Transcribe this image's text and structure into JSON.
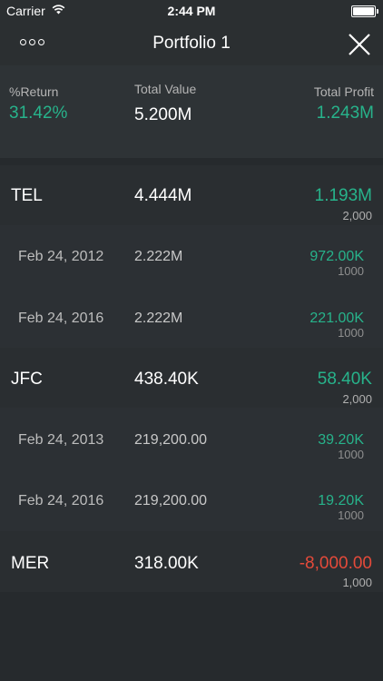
{
  "status": {
    "carrier": "Carrier",
    "time": "2:44 PM"
  },
  "nav": {
    "title": "Portfolio 1"
  },
  "summary": {
    "return_label": "%Return",
    "return_value": "31.42%",
    "value_label": "Total Value",
    "value_value": "5.200M",
    "profit_label": "Total Profit",
    "profit_value": "1.243M"
  },
  "holdings": [
    {
      "symbol": "TEL",
      "value": "4.444M",
      "profit": "1.193M",
      "quantity": "2,000",
      "lots": [
        {
          "date": "Feb 24, 2012",
          "value": "2.222M",
          "profit": "972.00K",
          "quantity": "1000"
        },
        {
          "date": "Feb 24, 2016",
          "value": "2.222M",
          "profit": "221.00K",
          "quantity": "1000"
        }
      ]
    },
    {
      "symbol": "JFC",
      "value": "438.40K",
      "profit": "58.40K",
      "quantity": "2,000",
      "lots": [
        {
          "date": "Feb 24, 2013",
          "value": "219,200.00",
          "profit": "39.20K",
          "quantity": "1000"
        },
        {
          "date": "Feb 24, 2016",
          "value": "219,200.00",
          "profit": "19.20K",
          "quantity": "1000"
        }
      ]
    },
    {
      "symbol": "MER",
      "value": "318.00K",
      "profit": "-8,000.00",
      "quantity": "1,000",
      "lots": []
    }
  ],
  "colors": {
    "gain": "#27b38b",
    "loss": "#e44a3a",
    "background": "#262a2d"
  }
}
